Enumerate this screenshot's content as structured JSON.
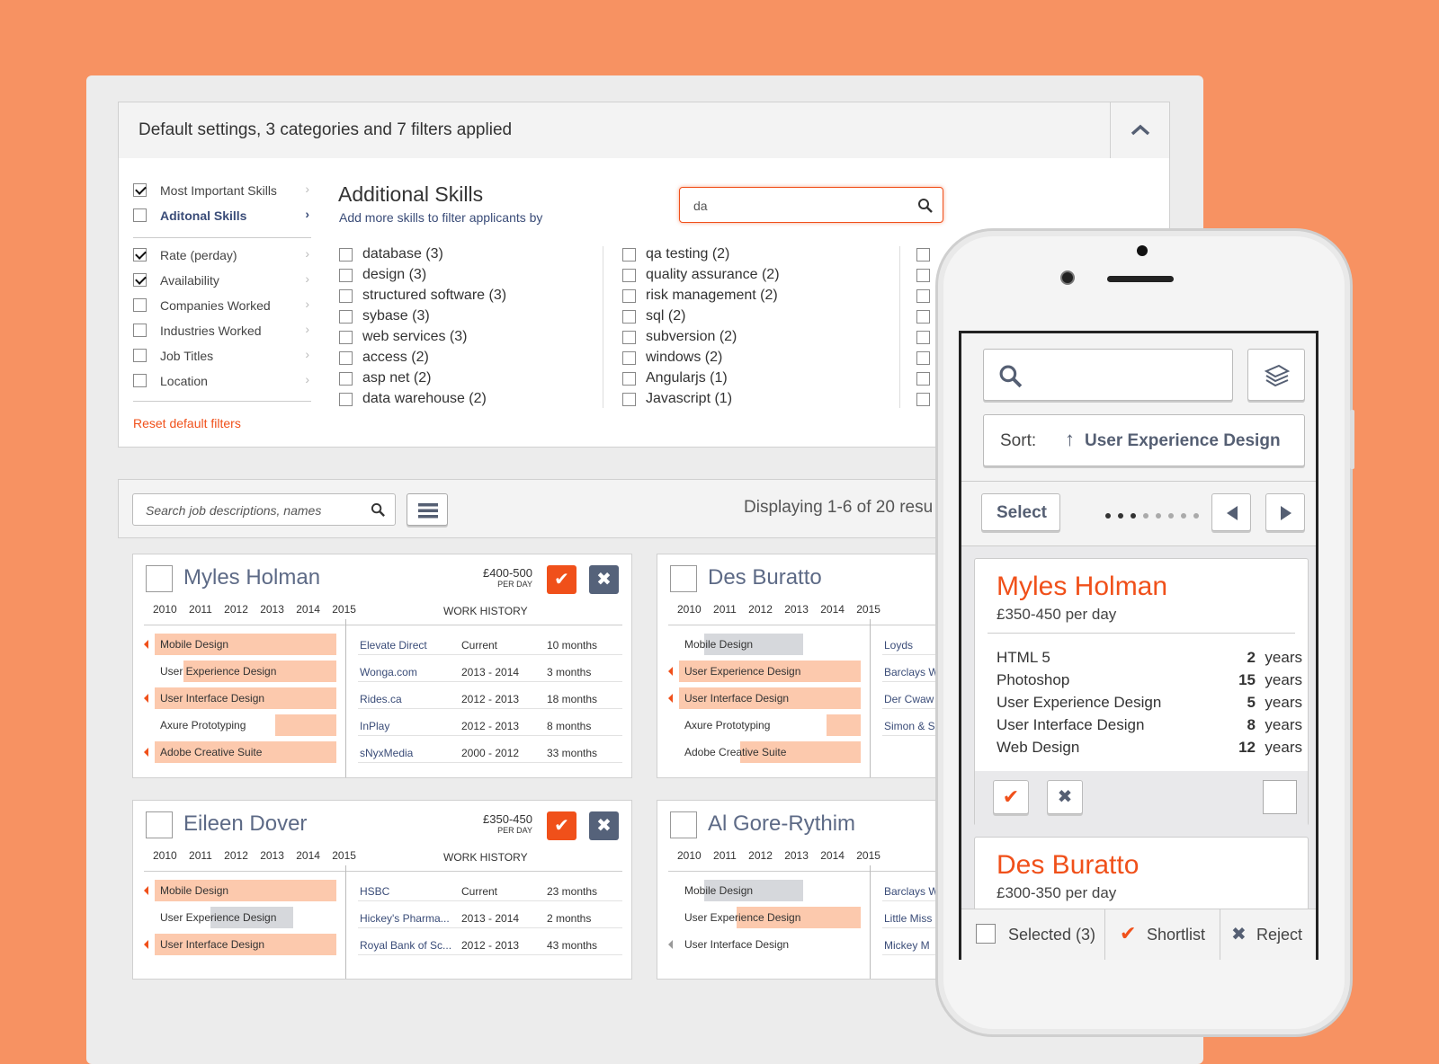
{
  "filter_header": {
    "title": "Default settings, 3 categories and 7 filters applied"
  },
  "sidebar": {
    "items": [
      {
        "label": "Most Important Skills",
        "checked": true
      },
      {
        "label": "Aditonal Skills",
        "checked": false,
        "active": true
      },
      {
        "label": "Rate (perday)",
        "checked": true
      },
      {
        "label": "Availability",
        "checked": true
      },
      {
        "label": "Companies Worked",
        "checked": false
      },
      {
        "label": "Industries Worked",
        "checked": false
      },
      {
        "label": "Job Titles",
        "checked": false
      },
      {
        "label": "Location",
        "checked": false
      }
    ],
    "reset_label": "Reset default filters"
  },
  "additional": {
    "title": "Additional Skills",
    "subtitle": "Add more skills to filter applicants by",
    "search_value": "da",
    "col1": [
      "database (3)",
      "design (3)",
      "structured software (3)",
      "sybase (3)",
      "web services (3)",
      "access (2)",
      "asp net (2)",
      "data warehouse (2)"
    ],
    "col2": [
      "qa testing (2)",
      "quality assurance (2)",
      "risk management (2)",
      "sql (2)",
      "subversion (2)",
      "windows (2)",
      "Angularjs (1)",
      "Javascript (1)"
    ]
  },
  "results": {
    "search_placeholder": "Search job descriptions, names",
    "display_text": "Displaying 1-6 of 20 resu"
  },
  "years": "2010 2011 2012 2013 2014 2015",
  "work_history_label": "WORK HISTORY",
  "cards": [
    {
      "name": "Myles Holman",
      "price": "£400-500",
      "per": "PER DAY",
      "skills": [
        "Mobile Design",
        "User Experience Design",
        "User Interface Design",
        "Axure Prototyping",
        "Adobe Creative Suite"
      ],
      "jobs": [
        {
          "company": "Elevate Direct",
          "period": "Current",
          "dur": "10 months"
        },
        {
          "company": "Wonga.com",
          "period": "2013 - 2014",
          "dur": "3 months"
        },
        {
          "company": "Rides.ca",
          "period": "2012 - 2013",
          "dur": "18 months"
        },
        {
          "company": "InPlay",
          "period": "2012 - 2013",
          "dur": "8 months"
        },
        {
          "company": "sNyxMedia",
          "period": "2000 - 2012",
          "dur": "33 months"
        }
      ]
    },
    {
      "name": "Des Buratto",
      "skills": [
        "Mobile Design",
        "User Experience Design",
        "User Interface Design",
        "Axure Prototyping",
        "Adobe Creative Suite"
      ],
      "companies": [
        "Loyds",
        "Barclays W",
        "Der Cwaw",
        "Simon & S"
      ]
    },
    {
      "name": "Eileen Dover",
      "price": "£350-450",
      "per": "PER DAY",
      "skills": [
        "Mobile Design",
        "User Experience Design",
        "User Interface Design"
      ],
      "jobs": [
        {
          "company": "HSBC",
          "period": "Current",
          "dur": "23 months"
        },
        {
          "company": "Hickey's Pharma...",
          "period": "2013 - 2014",
          "dur": "2 months"
        },
        {
          "company": "Royal Bank of Sc...",
          "period": "2012 - 2013",
          "dur": "43 months"
        }
      ]
    },
    {
      "name": "Al Gore-Rythim",
      "skills": [
        "Mobile Design",
        "User Experience Design",
        "User Interface Design"
      ],
      "companies": [
        "Barclays W",
        "Little Miss",
        "Mickey M"
      ]
    }
  ],
  "phone": {
    "sort_label": "Sort:",
    "sort_value": "User Experience Design",
    "select_label": "Select",
    "candidates": [
      {
        "name": "Myles Holman",
        "price": "£350-450 per day",
        "skills": [
          {
            "name": "HTML 5",
            "years": "2"
          },
          {
            "name": "Photoshop",
            "years": "15"
          },
          {
            "name": "User Experience Design",
            "years": "5"
          },
          {
            "name": "User Interface Design",
            "years": "8"
          },
          {
            "name": "Web Design",
            "years": "12"
          }
        ]
      },
      {
        "name": "Des Buratto",
        "price": "£300-350 per day"
      }
    ],
    "years_word": "years",
    "bottom": {
      "selected": "Selected (3)",
      "shortlist": "Shortlist",
      "reject": "Reject"
    }
  }
}
